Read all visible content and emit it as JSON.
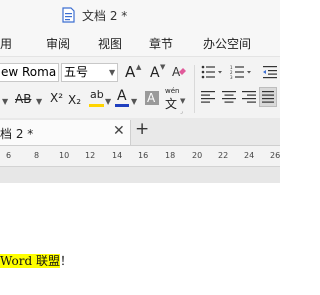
{
  "titlebar": {
    "title": "文档 2 *"
  },
  "menu": {
    "items": [
      "用",
      "审阅",
      "视图",
      "章节",
      "办公空间"
    ]
  },
  "ribbon": {
    "font_name": "ew Roma",
    "font_size": "五号",
    "grow_font": "A",
    "shrink_font": "A",
    "strikethrough": "AB",
    "superscript": "X²",
    "subscript": "X₂",
    "highlight": "ab",
    "font_color": "A",
    "char_shading": "A",
    "phonetic_top": "wén",
    "phonetic_bottom": "文"
  },
  "tabbar": {
    "tab_label": "档 2 *",
    "close": "✕",
    "new_tab": "+"
  },
  "ruler": {
    "numbers": [
      "6",
      "8",
      "10",
      "12",
      "14",
      "16",
      "18",
      "20",
      "22",
      "24",
      "26"
    ]
  },
  "document": {
    "highlighted_text": "Word 联盟",
    "trailing_text": "！"
  },
  "colors": {
    "highlight": "#ffff00",
    "font_color_bar": "#1f3fbf",
    "text_highlight_bar": "#ffd400",
    "active_button": "#d9d9d9"
  }
}
